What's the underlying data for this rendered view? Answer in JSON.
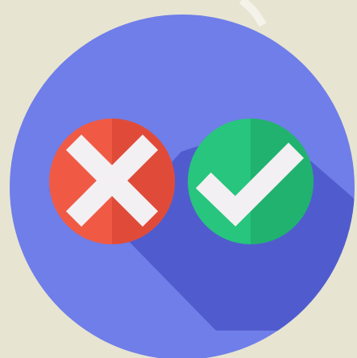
{
  "colors": {
    "background": "#e7e4d2",
    "main_circle": "#6f7ee8",
    "shadow": "#4f5bcc",
    "red_badge": "#f05a45",
    "red_badge_shade": "#db4736",
    "green_badge": "#27c57d",
    "green_badge_shade": "#1faa69",
    "mark": "#f2f0f2"
  },
  "icons": {
    "reject": "close-x-icon",
    "accept": "check-mark-icon"
  }
}
